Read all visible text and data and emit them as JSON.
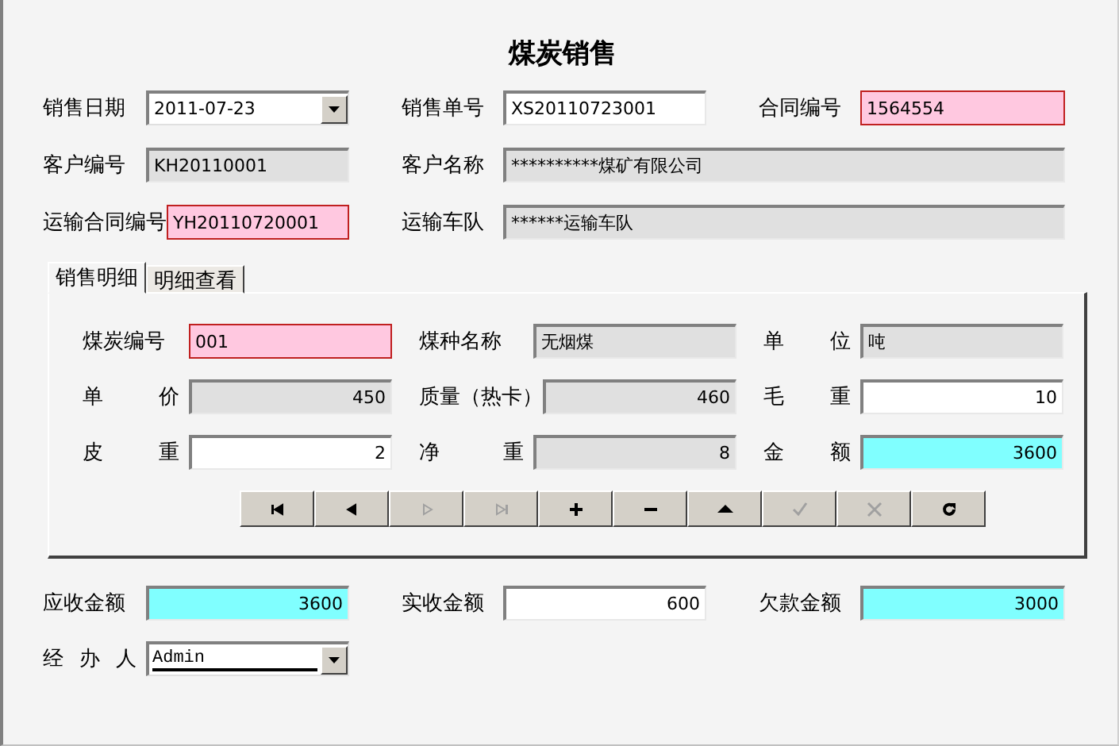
{
  "window": {
    "title": "煤炭销售"
  },
  "header_rows": [
    [
      {
        "label": "销售日期",
        "value": "2011-07-23",
        "kind": "date",
        "required": false,
        "readonly": false,
        "computed": false
      },
      {
        "label": "销售单号",
        "value": "XS20110723001",
        "kind": "text",
        "required": false,
        "readonly": false,
        "computed": false
      },
      {
        "label": "合同编号",
        "value": "1564554",
        "kind": "text",
        "required": true,
        "readonly": false,
        "computed": false
      }
    ],
    [
      {
        "label": "客户编号",
        "value": "KH20110001",
        "kind": "text",
        "required": false,
        "readonly": true,
        "computed": false
      },
      {
        "label": "客户名称",
        "value": "**********煤矿有限公司",
        "kind": "text",
        "required": false,
        "readonly": true,
        "computed": false
      }
    ],
    [
      {
        "label": "运输合同编号",
        "value": "YH20110720001",
        "kind": "text",
        "required": true,
        "readonly": false,
        "computed": false
      },
      {
        "label": "运输车队",
        "value": "******运输车队",
        "kind": "text",
        "required": false,
        "readonly": true,
        "computed": false
      }
    ]
  ],
  "tabs": [
    {
      "label": "销售明细",
      "selected": true
    },
    {
      "label": "明细查看",
      "selected": false
    }
  ],
  "detail_rows": [
    [
      {
        "label": "煤炭编号",
        "value": "001",
        "kind": "text",
        "required": true,
        "readonly": false,
        "computed": false
      },
      {
        "label": "煤种名称",
        "value": "无烟煤",
        "kind": "text",
        "required": false,
        "readonly": true,
        "computed": false
      },
      {
        "label": "单 位",
        "value": "吨",
        "kind": "text",
        "required": false,
        "readonly": true,
        "computed": false
      }
    ],
    [
      {
        "label": "单 价",
        "value": "450",
        "kind": "number",
        "required": false,
        "readonly": true,
        "computed": false
      },
      {
        "label": "质量（热卡）",
        "value": "460",
        "kind": "number",
        "required": false,
        "readonly": true,
        "computed": false
      },
      {
        "label": "毛 重",
        "value": "10",
        "kind": "number",
        "required": false,
        "readonly": false,
        "computed": false
      }
    ],
    [
      {
        "label": "皮 重",
        "value": "2",
        "kind": "number",
        "required": false,
        "readonly": false,
        "computed": false
      },
      {
        "label": "净 重",
        "value": "8",
        "kind": "number",
        "required": false,
        "readonly": true,
        "computed": false
      },
      {
        "label": "金 额",
        "value": "3600",
        "kind": "number",
        "required": false,
        "readonly": false,
        "computed": true
      }
    ]
  ],
  "navigator": [
    {
      "kind": "first",
      "disabled": false
    },
    {
      "kind": "prior",
      "disabled": false
    },
    {
      "kind": "next",
      "disabled": true
    },
    {
      "kind": "last",
      "disabled": true
    },
    {
      "kind": "insert",
      "disabled": false
    },
    {
      "kind": "delete",
      "disabled": false
    },
    {
      "kind": "edit",
      "disabled": false
    },
    {
      "kind": "post",
      "disabled": true
    },
    {
      "kind": "cancel",
      "disabled": true
    },
    {
      "kind": "refresh",
      "disabled": false
    }
  ],
  "footer_rows": [
    [
      {
        "label": "应收金额",
        "value": "3600",
        "kind": "number",
        "required": false,
        "readonly": false,
        "computed": true
      },
      {
        "label": "实收金额",
        "value": "600",
        "kind": "number",
        "required": false,
        "readonly": false,
        "computed": false
      },
      {
        "label": "欠款金额",
        "value": "3000",
        "kind": "number",
        "required": false,
        "readonly": false,
        "computed": true
      }
    ],
    [
      {
        "label": "经 办 人",
        "value": "Admin",
        "kind": "dropdown",
        "required": false,
        "readonly": false,
        "computed": false
      }
    ]
  ]
}
